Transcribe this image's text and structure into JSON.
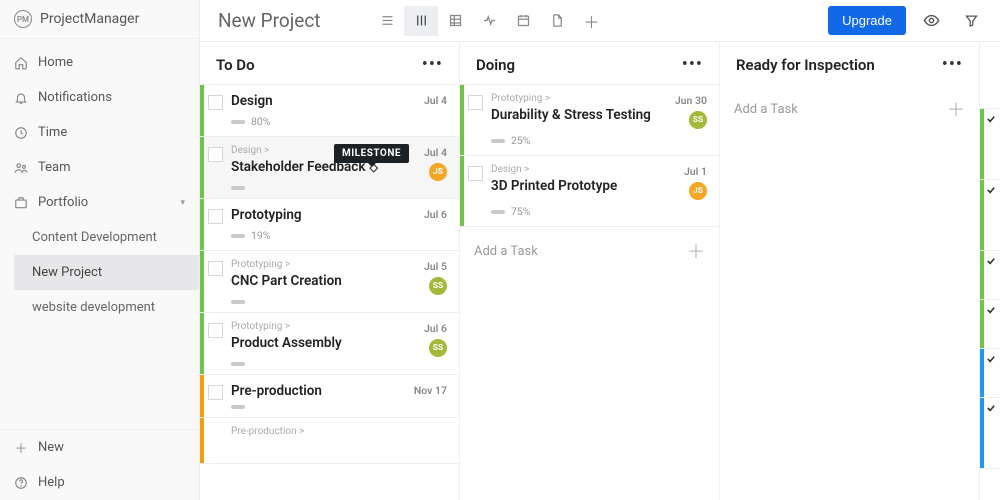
{
  "brand": {
    "badge": "PM",
    "name": "ProjectManager"
  },
  "sidebar": {
    "items": [
      {
        "label": "Home"
      },
      {
        "label": "Notifications"
      },
      {
        "label": "Time"
      },
      {
        "label": "Team"
      },
      {
        "label": "Portfolio"
      }
    ],
    "portfolio_children": [
      {
        "label": "Content Development"
      },
      {
        "label": "New Project"
      },
      {
        "label": "website development"
      }
    ],
    "bottom": [
      {
        "label": "New"
      },
      {
        "label": "Help"
      }
    ]
  },
  "project_title": "New Project",
  "upgrade_label": "Upgrade",
  "tooltip_milestone": "MILESTONE",
  "columns": {
    "todo": {
      "title": "To Do",
      "cards": [
        {
          "title": "Design",
          "date": "Jul 4",
          "pct": "80%",
          "accent": "#6fc24a"
        },
        {
          "crumb": "Design >",
          "title": "Stakeholder Feedback",
          "date": "Jul 4",
          "accent": "#6fc24a",
          "avatar": "JS",
          "diamond": true,
          "selected": true
        },
        {
          "title": "Prototyping",
          "date": "Jul 6",
          "pct": "19%",
          "accent": "#6fc24a"
        },
        {
          "crumb": "Prototyping >",
          "title": "CNC Part Creation",
          "date": "Jul 5",
          "accent": "#6fc24a",
          "avatar": "SS"
        },
        {
          "crumb": "Prototyping >",
          "title": "Product Assembly",
          "date": "Jul 6",
          "accent": "#6fc24a",
          "avatar": "SS"
        },
        {
          "title": "Pre-production",
          "date": "Nov 17",
          "accent": "#f39c12"
        },
        {
          "crumb": "Pre-production >",
          "title": "",
          "accent": "#f39c12"
        }
      ]
    },
    "doing": {
      "title": "Doing",
      "cards": [
        {
          "crumb": "Prototyping >",
          "title": "Durability & Stress Testing",
          "date": "Jun 30",
          "pct": "25%",
          "accent": "#6fc24a",
          "avatar": "SS"
        },
        {
          "crumb": "Design >",
          "title": "3D Printed Prototype",
          "date": "Jul 1",
          "pct": "75%",
          "accent": "#6fc24a",
          "avatar": "JS"
        }
      ],
      "add": "Add a Task"
    },
    "ready": {
      "title": "Ready for Inspection",
      "add": "Add a Task"
    }
  },
  "edge_stubs": [
    {
      "accent": "#6fc24a"
    },
    {
      "accent": "#6fc24a"
    },
    {
      "accent": "#6fc24a"
    },
    {
      "accent": "#6fc24a"
    },
    {
      "accent": "#2196f3"
    },
    {
      "accent": "#2196f3"
    }
  ]
}
